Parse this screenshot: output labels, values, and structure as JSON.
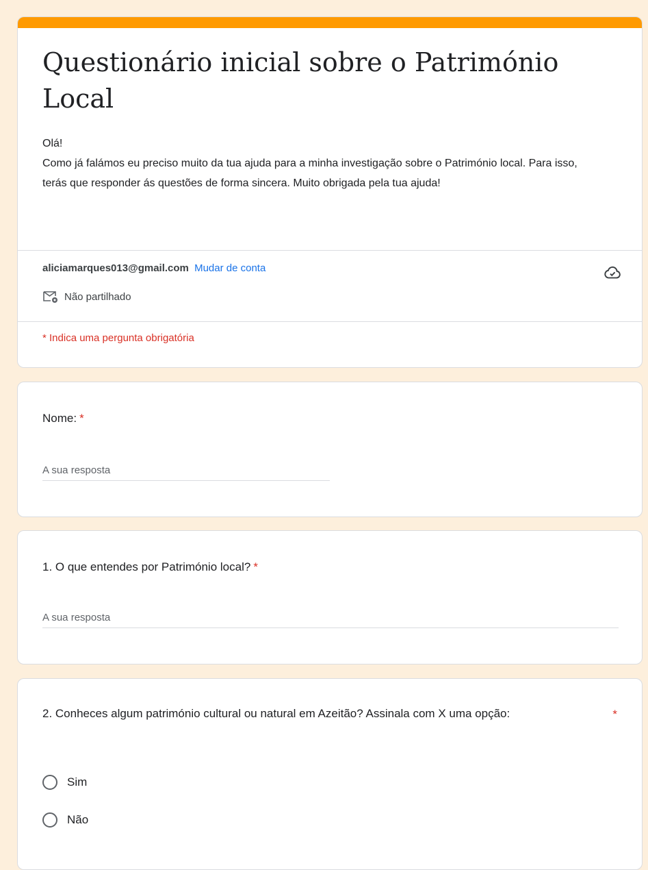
{
  "header": {
    "title": "Questionário inicial sobre o Património Local",
    "description": "Olá!\nComo já falámos eu preciso muito da tua ajuda para a minha investigação sobre o Património local. Para isso, terás que responder ás questões de forma sincera. Muito obrigada pela tua ajuda!",
    "accent_color": "#ff9a00"
  },
  "account": {
    "email": "aliciamarques013@gmail.com",
    "switch_label": "Mudar de conta",
    "shared_status": "Não partilhado",
    "cloud_icon": "cloud-check-icon",
    "share_icon": "mail-lock-icon"
  },
  "required_note": "* Indica uma pergunta obrigatória",
  "questions": [
    {
      "title": "Nome:",
      "required": "*",
      "placeholder": "A sua resposta"
    },
    {
      "title": "1. O que entendes por Património local?",
      "required": "*",
      "placeholder": "A sua resposta"
    },
    {
      "title": "2. Conheces algum património cultural ou natural em Azeitão? Assinala com X uma opção:",
      "required": "*",
      "options": [
        "Sim",
        "Não"
      ]
    }
  ]
}
